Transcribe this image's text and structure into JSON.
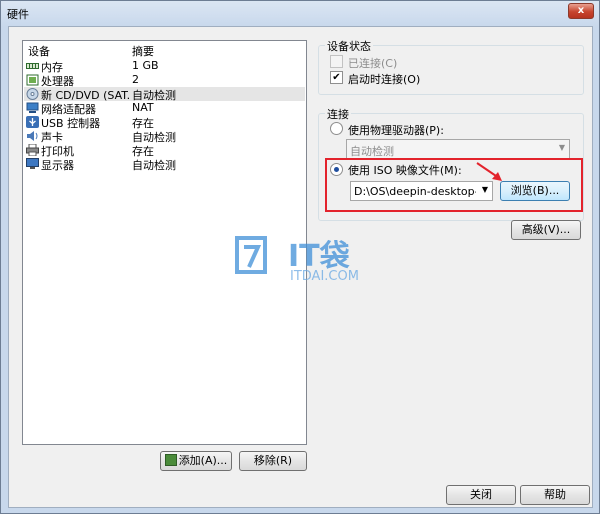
{
  "window": {
    "title": "硬件",
    "close_symbol": "x"
  },
  "devices": {
    "col_device": "设备",
    "col_summary": "摘要",
    "rows": [
      {
        "name": "内存",
        "summary": "1 GB",
        "icon": "memory-icon"
      },
      {
        "name": "处理器",
        "summary": "2",
        "icon": "processor-icon"
      },
      {
        "name": "新 CD/DVD (SAT...",
        "summary": "自动检测",
        "icon": "cd-dvd-icon"
      },
      {
        "name": "网络适配器",
        "summary": "NAT",
        "icon": "network-adapter-icon"
      },
      {
        "name": "USB 控制器",
        "summary": "存在",
        "icon": "usb-icon"
      },
      {
        "name": "声卡",
        "summary": "自动检测",
        "icon": "sound-card-icon"
      },
      {
        "name": "打印机",
        "summary": "存在",
        "icon": "printer-icon"
      },
      {
        "name": "显示器",
        "summary": "自动检测",
        "icon": "display-icon"
      }
    ],
    "selected_index": 2
  },
  "buttons": {
    "add": "添加(A)...",
    "remove": "移除(R)",
    "close": "关闭",
    "help": "帮助",
    "browse": "浏览(B)...",
    "advanced": "高级(V)..."
  },
  "device_status": {
    "title": "设备状态",
    "connected": {
      "label": "已连接(C)",
      "checked": false,
      "enabled": false
    },
    "connect_at_power_on": {
      "label": "启动时连接(O)",
      "checked": true
    }
  },
  "connection": {
    "title": "连接",
    "physical_drive": {
      "label": "使用物理驱动器(P):",
      "selected": false
    },
    "physical_drive_value": "自动检测",
    "iso_image": {
      "label": "使用 ISO 映像文件(M):",
      "selected": true
    },
    "iso_path": "D:\\OS\\deepin-desktop-community"
  },
  "watermark": {
    "brand": "IT袋",
    "url": "ITDAI.COM"
  },
  "colors": {
    "highlight": "#e3232c",
    "watermark": "#3f8fd8"
  }
}
